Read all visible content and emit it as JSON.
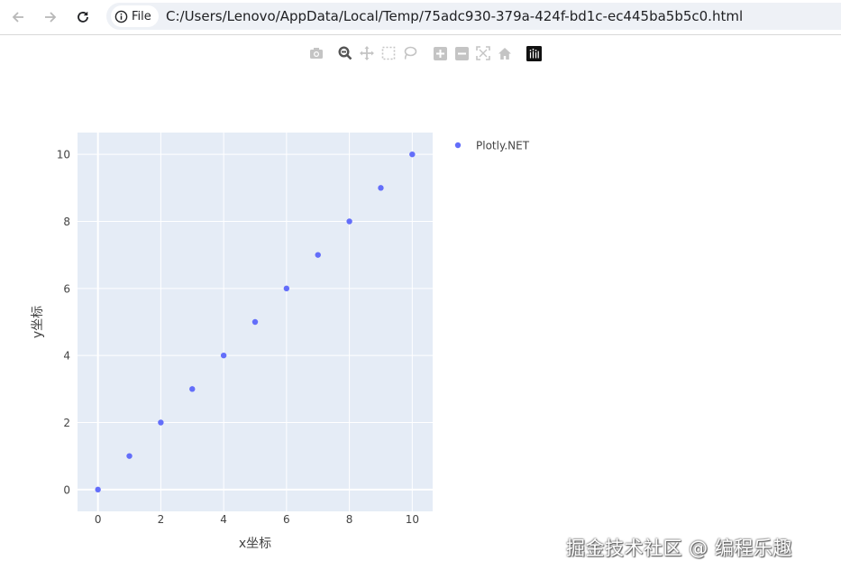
{
  "browser": {
    "file_chip_label": "File",
    "url": "C:/Users/Lenovo/AppData/Local/Temp/75adc930-379a-424f-bd1c-ec445ba5b5c0.html"
  },
  "modebar": {
    "icons": [
      "camera-icon",
      "zoom-icon",
      "pan-icon",
      "box-select-icon",
      "lasso-icon",
      "zoom-in-icon",
      "zoom-out-icon",
      "autoscale-icon",
      "reset-axes-icon",
      "plotly-logo-icon"
    ]
  },
  "colors": {
    "plot_bg": "#e5ecf6",
    "grid": "#ffffff",
    "marker": "#636efa"
  },
  "chart_data": {
    "type": "scatter",
    "x": [
      0,
      1,
      2,
      3,
      4,
      5,
      6,
      7,
      8,
      9,
      10
    ],
    "series": [
      {
        "name": "Plotly.NET",
        "values": [
          0,
          1,
          2,
          3,
          4,
          5,
          6,
          7,
          8,
          9,
          10
        ]
      }
    ],
    "xlabel": "x坐标",
    "ylabel": "y坐标",
    "xlim": [
      -0.65,
      10.65
    ],
    "ylim": [
      -0.65,
      10.65
    ],
    "xticks": [
      0,
      2,
      4,
      6,
      8,
      10
    ],
    "yticks": [
      0,
      2,
      4,
      6,
      8,
      10
    ],
    "grid": true,
    "legend": "top-right outside"
  },
  "watermark": "掘金技术社区 @ 编程乐趣"
}
